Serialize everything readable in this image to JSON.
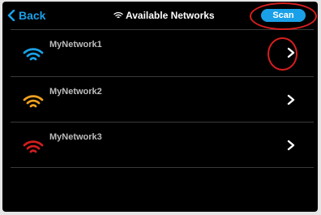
{
  "header": {
    "back_label": "Back",
    "title": "Available Networks",
    "scan_label": "Scan"
  },
  "networks": [
    {
      "name": "MyNetwork1",
      "signal_color": "#1aa0e8",
      "icon": "wifi-icon"
    },
    {
      "name": "MyNetwork2",
      "signal_color": "#f0a020",
      "icon": "wifi-icon"
    },
    {
      "name": "MyNetwork3",
      "signal_color": "#d01e1e",
      "icon": "wifi-icon"
    }
  ],
  "colors": {
    "accent": "#1aa0e8",
    "highlight_ring": "#d81e1e",
    "background": "#000000"
  }
}
